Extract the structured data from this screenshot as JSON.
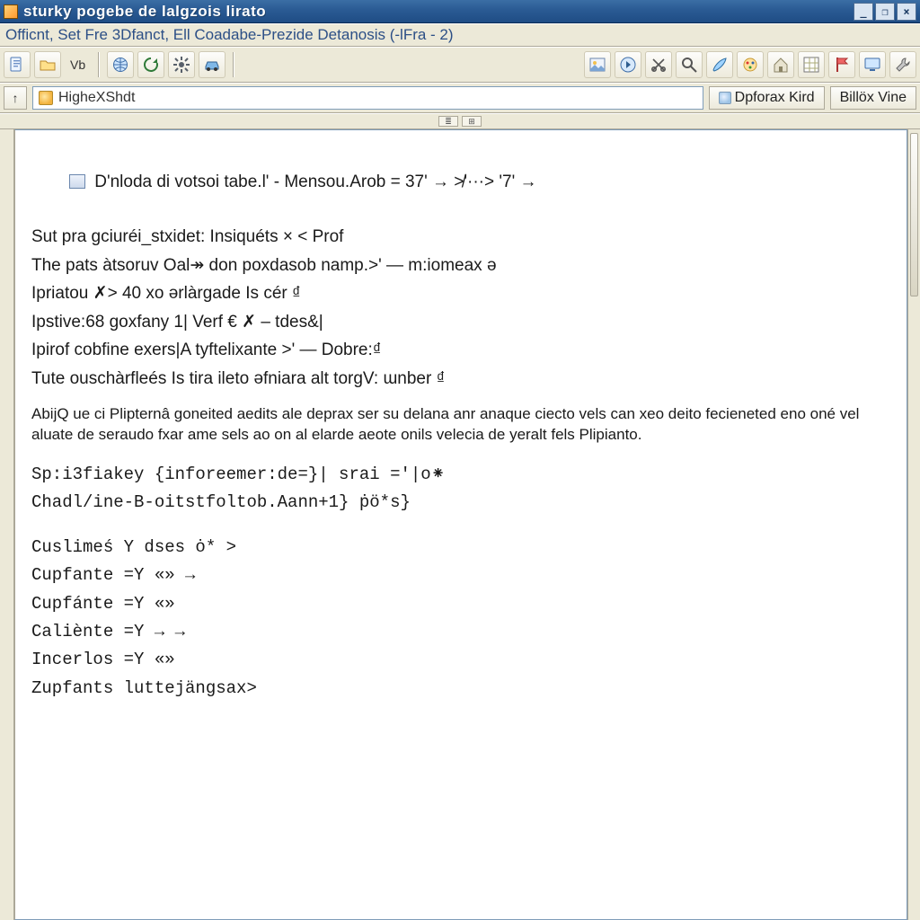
{
  "titlebar": {
    "text": "sturky pogebe de lalgzois lirato",
    "buttons": {
      "min": "_",
      "max": "❐",
      "close": "×"
    }
  },
  "menubar": {
    "text": "Officnt, Set Fre 3Dfanct, Ell Coadabe-Prezide Detanosis (-lFra - 2)"
  },
  "toolbar": {
    "vb_label": "Vb"
  },
  "pathbar": {
    "up_glyph": "↑",
    "value": "HigheXShdt",
    "btn1": "Dpforax Kird",
    "btn2": "Billöx  Vine"
  },
  "splitter": {
    "a": "≣",
    "b": "⊞"
  },
  "doc": {
    "l1": "D'nloda di votsoi tabe.l' - Mensou.Arob = 37' → ≯'···> '7' →",
    "l2": "Sut pra gciuréi_stxidet: Insiquéts × < Prof",
    "l3": "The pats àtsoruv Oal↠ don poxdasob namp.>' — m:iomeax ə",
    "l4": "Ipriatou ✗> 40 xo ərlàrgade Is cér ₫",
    "l5": "Ipstive:68 goxfany 1| Verf € ✗ – tdes&|",
    "l6": "Ipirof cobfine exers|A tyftelixante >' — Dobre:₫",
    "l7": "Tute ouschàrfleés Is tira ileto əfniara alt torgV: ɯnber ₫",
    "para": "AbijQ ue ci Plipternâ goneited aedits ale deprax ser su delana anr anaque ciecto vels can xeo deito fecieneted eno oné vel aluate de seraudo fxar ame sels ao on al elarde aeote onils velecia de yeralt fels Plipianto.",
    "l8": "Sp:i3fiakey {inforeemer:de=}| srai ='|o⁕",
    "l9": "Chadl/ine-B-oitstfoltob.Aann+1} ṗö*s}",
    "l10": "Cuslimeś Y dses ȯ* >",
    "l11": "Cupfante =Y «» →",
    "l12": "Cupfánte =Y «»",
    "l13": "Caliènte =Y → →",
    "l14": "Incerlos =Y «»",
    "l15": "Zupfants luttejängsax>"
  }
}
